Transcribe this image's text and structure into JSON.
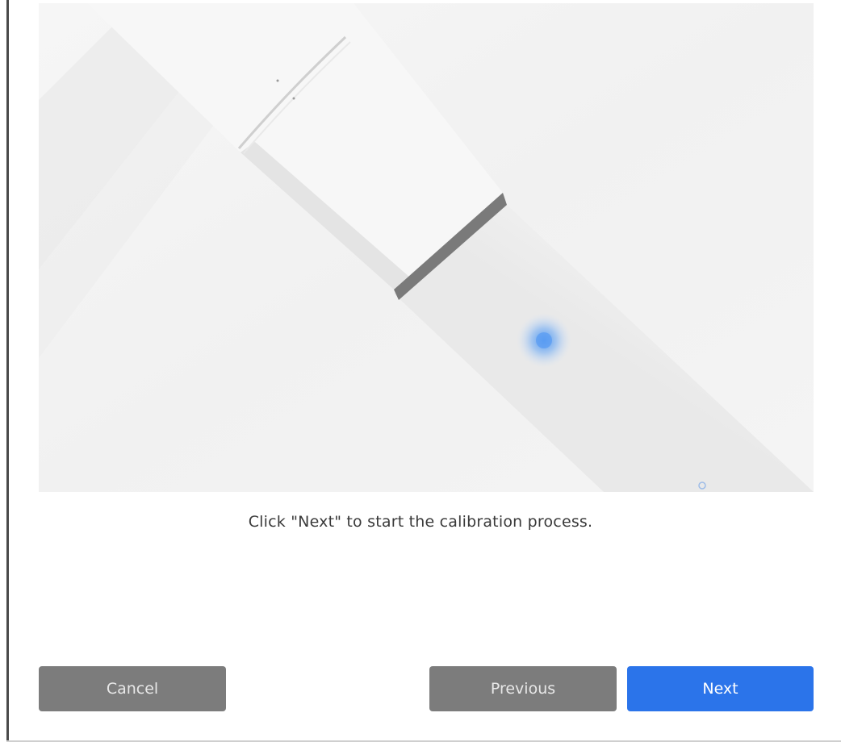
{
  "dialog": {
    "instruction": "Click \"Next\" to start the calibration process.",
    "illustration": {
      "subject": "stylus-pen-illustration",
      "highlight_color": "#3b8cf0"
    }
  },
  "buttons": {
    "cancel_label": "Cancel",
    "previous_label": "Previous",
    "next_label": "Next"
  },
  "colors": {
    "secondary_button": "#7c7c7c",
    "primary_button": "#2b74ea"
  }
}
